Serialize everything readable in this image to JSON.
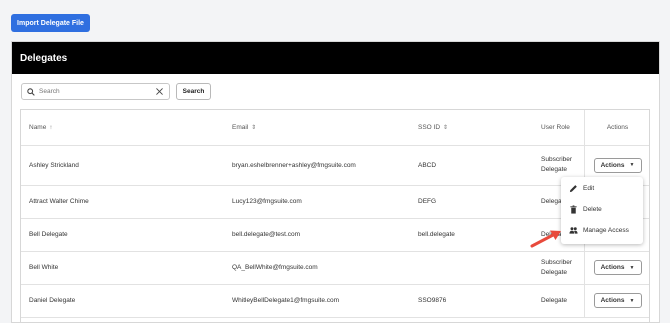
{
  "import_button": {
    "label": "Import Delegate File"
  },
  "panel": {
    "title": "Delegates"
  },
  "search": {
    "placeholder": "Search",
    "button_label": "Search"
  },
  "table": {
    "columns": [
      {
        "label": "Name",
        "sort": "↑"
      },
      {
        "label": "Email",
        "sort": "⇕"
      },
      {
        "label": "SSO ID",
        "sort": "⇕"
      },
      {
        "label": "User Role"
      },
      {
        "label": "Actions"
      }
    ],
    "rows": [
      {
        "name": "Ashley Strickland",
        "email": "bryan.eshelbrenner+ashley@fmgsuite.com",
        "sso": "ABCD",
        "role": "Subscriber Delegate",
        "action": "Actions"
      },
      {
        "name": "Attract Walter Chime",
        "email": "Lucy123@fmgsuite.com",
        "sso": "DEFG",
        "role": "Delega",
        "action": ""
      },
      {
        "name": "Bell Delegate",
        "email": "bell.delegate@test.com",
        "sso": "bell.delegate",
        "role": "Delega",
        "action": ""
      },
      {
        "name": "Bell White",
        "email": "QA_BellWhite@fmgsuite.com",
        "sso": "",
        "role": "Subscriber Delegate",
        "action": "Actions"
      },
      {
        "name": "Daniel Delegate",
        "email": "WhitleyBellDelegate1@fmgsuite.com",
        "sso": "SSO9876",
        "role": "Delegate",
        "action": "Actions"
      }
    ]
  },
  "dropdown": {
    "items": [
      {
        "label": "Edit",
        "icon": "pencil-icon"
      },
      {
        "label": "Delete",
        "icon": "trash-icon"
      },
      {
        "label": "Manage Access",
        "icon": "people-icon"
      }
    ]
  },
  "colors": {
    "primary": "#2f6fe0",
    "header_bg": "#000000",
    "arrow": "#e84a3c"
  }
}
